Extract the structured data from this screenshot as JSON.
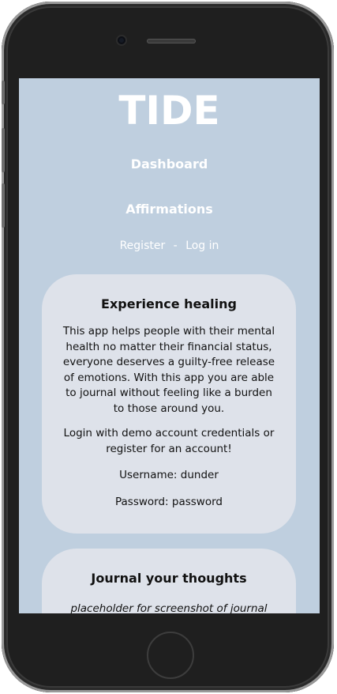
{
  "app": {
    "title": "TIDE"
  },
  "nav": {
    "items": [
      "Dashboard",
      "Affirmations"
    ]
  },
  "auth": {
    "register": "Register",
    "separator": "-",
    "login": "Log in"
  },
  "cards": [
    {
      "heading": "Experience healing",
      "paragraphs": [
        "This app helps people with their mental health no matter their financial status, everyone deserves a guilty-free release of emotions. With this app you are able to journal without feeling like a burden to those around you.",
        "Login with demo account credentials or register for an account!",
        "Username: dunder",
        "Password: password"
      ]
    },
    {
      "heading": "Journal your thoughts",
      "paragraphs": [
        "placeholder for screenshot of journal entry"
      ]
    }
  ],
  "colors": {
    "screen_bg": "#bfcfdf",
    "card_bg": "#dee2ea",
    "text_light": "#ffffff",
    "phone_body": "#1f1f1f"
  }
}
